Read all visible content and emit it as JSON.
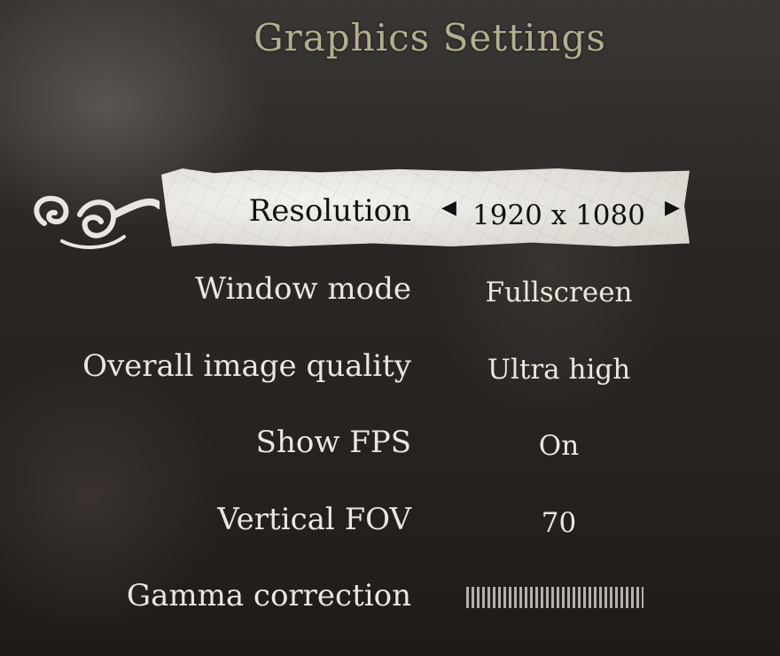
{
  "title": "Graphics Settings",
  "settings": [
    {
      "label": "Resolution",
      "value": "1920 x 1080",
      "selected": true
    },
    {
      "label": "Window mode",
      "value": "Fullscreen"
    },
    {
      "label": "Overall image quality",
      "value": "Ultra high"
    },
    {
      "label": "Show FPS",
      "value": "On"
    },
    {
      "label": "Vertical FOV",
      "value": "70"
    },
    {
      "label": "Gamma correction",
      "value_fraction": 1.0
    }
  ],
  "colors": {
    "text": "#ebe7de",
    "title": "#b4ae8c",
    "ribbon": "#f0eee9",
    "selected_text": "#111111"
  },
  "icons": [
    "arrow-left-icon",
    "arrow-right-icon",
    "ornament-swirl-icon"
  ]
}
